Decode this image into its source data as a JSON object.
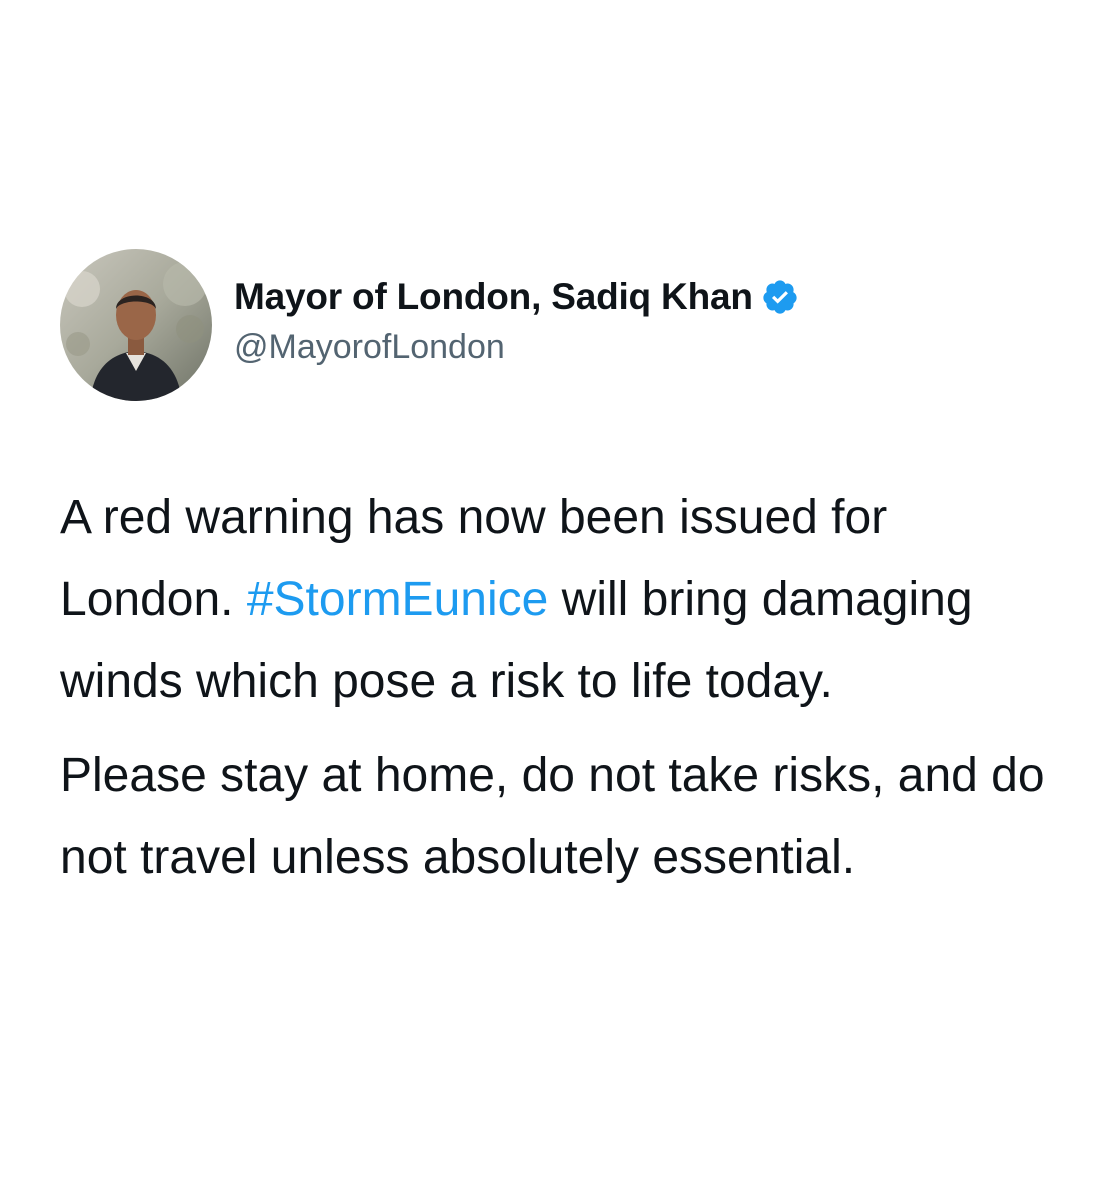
{
  "tweet": {
    "author": {
      "display_name": "Mayor of London, Sadiq Khan",
      "handle": "@MayorofLondon",
      "verified": true,
      "avatar_icon": "profile-photo"
    },
    "paragraph_1": {
      "before": "A red warning has now been issued for London. ",
      "hashtag": "#StormEunice",
      "after": " will bring damaging winds which pose a risk to life today."
    },
    "paragraph_2": "Please stay at home, do not take risks, and do not travel unless absolutely essential."
  },
  "colors": {
    "text": "#0f1419",
    "secondary_text": "#536471",
    "link": "#1d9bf0",
    "verified_badge": "#1d9bf0"
  }
}
